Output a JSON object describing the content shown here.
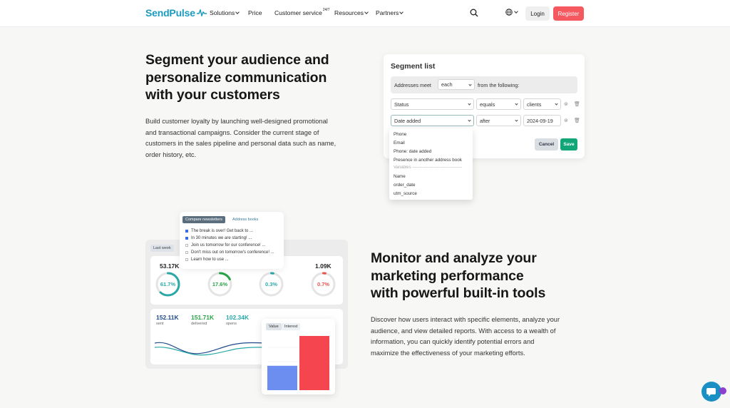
{
  "header": {
    "logo": "SendPulse",
    "nav": [
      {
        "label": "Solutions",
        "dropdown": true
      },
      {
        "label": "Price",
        "dropdown": false
      },
      {
        "label": "Customer service",
        "sup": "24/7",
        "dropdown": false
      },
      {
        "label": "Resources",
        "dropdown": true
      },
      {
        "label": "Partners",
        "dropdown": true
      }
    ],
    "login": "Login",
    "register": "Register"
  },
  "section1": {
    "title_lines": [
      "Segment your audience and",
      "personalize communication",
      "with your customers"
    ],
    "text_lines": [
      "Build customer loyalty by launching well-designed promotional",
      "and transactional campaigns. Consider the current stage of",
      "customers in the sales pipeline and personal data such as name,",
      "order history, etc."
    ]
  },
  "segment": {
    "title": "Segment list",
    "addresses_meet": "Addresses meet",
    "each": "each",
    "from_following": "from the following:",
    "row1": {
      "field": "Status",
      "op": "equals",
      "value": "clients"
    },
    "row2": {
      "field": "Date added",
      "op": "after",
      "value": "2024-09-19"
    },
    "cancel": "Cancel",
    "save": "Save",
    "dropdown_items": [
      "Phone",
      "Email",
      "Phone: date added",
      "Presence in another address book"
    ],
    "dropdown_sep": "Variables -----------------------------------",
    "dropdown_vars": [
      "Name",
      "order_date",
      "utm_source"
    ]
  },
  "section2": {
    "title_lines": [
      "Monitor and analyze your",
      "marketing performance",
      "with powerful built-in tools"
    ],
    "text_lines": [
      "Discover how users interact with specific elements, analyze your",
      "audience, and view detailed reports. With access to a wealth of",
      "information, you can quickly identify potential errors and",
      "maximize the effectiveness of your marketing efforts."
    ]
  },
  "analytics": {
    "week_tab": "Last week",
    "stats": [
      {
        "num": "53.17K",
        "pct": "61.7%",
        "value": 61.7,
        "color": "#2aa8a8"
      },
      {
        "num": "",
        "pct": "17.6%",
        "value": 17.6,
        "color": "#27a346"
      },
      {
        "num": "",
        "pct": "0.3%",
        "value": 0.3,
        "color": "#2aa8a8"
      },
      {
        "num": "1.09K",
        "pct": "0.7%",
        "value": 0.7,
        "color": "#e8524f"
      }
    ],
    "bottom": [
      {
        "num": "152.11K",
        "label": "sent",
        "color": "#1e4a8a"
      },
      {
        "num": "151.71K",
        "label": "delivered",
        "color": "#27a346"
      },
      {
        "num": "102.34K",
        "label": "opens",
        "color": "#2aa8a8"
      }
    ],
    "newsletter_tabs": [
      "Compare newsletters",
      "Address books"
    ],
    "newsletters": [
      {
        "text": "The break is over! Get back to ...",
        "checked": true
      },
      {
        "text": "In 30 minutes we are starting! ...",
        "checked": true
      },
      {
        "text": "Join us tomorrow for our conference! ...",
        "checked": false
      },
      {
        "text": "Don't miss out on tomorrow's conference! ...",
        "checked": false
      },
      {
        "text": "Learn how to use ...",
        "checked": false
      }
    ],
    "bar_tabs": [
      "Value",
      "Interest"
    ],
    "bars": [
      {
        "value": 45,
        "color": "#6b8ef0"
      },
      {
        "value": 100,
        "color": "#f5454f"
      }
    ]
  }
}
